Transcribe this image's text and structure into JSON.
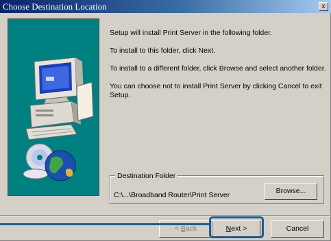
{
  "window": {
    "title": "Choose Destination Location",
    "close_glyph": "x"
  },
  "content": {
    "line1": "Setup will install Print Server in the following folder.",
    "line2": "To install to this folder, click Next.",
    "line3": "To install to a different folder, click Browse and select another folder.",
    "line4": "You can choose not to install Print Server by clicking Cancel to exit Setup."
  },
  "destination": {
    "group_label": "Destination Folder",
    "path": "C:\\...\\Broadband Router\\Print Server",
    "browse_label": "Browse..."
  },
  "buttons": {
    "back_accel": "B",
    "back_rest": "ack",
    "back_prefix": "< ",
    "next_accel": "N",
    "next_rest": "ext >",
    "cancel_label": "Cancel"
  },
  "icons": {
    "artwork": "computer-with-cds-illustration",
    "callout": "highlight-callout"
  },
  "colors": {
    "panel": "#008080",
    "titlebar": "#0a246a",
    "callout": "#1f5c90"
  }
}
